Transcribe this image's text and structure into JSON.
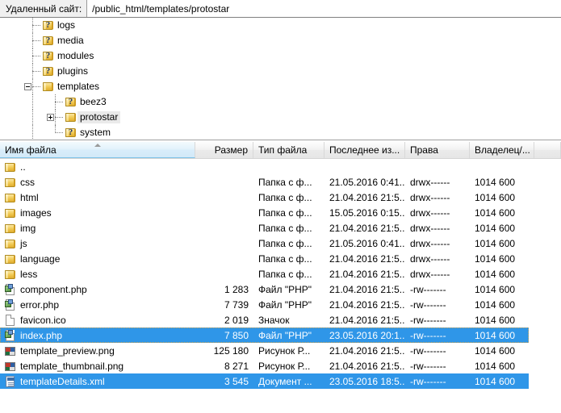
{
  "pathbar": {
    "label": "Удаленный сайт:",
    "path": "/public_html/templates/protostar"
  },
  "tree": {
    "items": [
      {
        "label": "logs",
        "icon": "folder-unknown-icon",
        "indent": 0,
        "expander": "none",
        "selected": false
      },
      {
        "label": "media",
        "icon": "folder-unknown-icon",
        "indent": 0,
        "expander": "none",
        "selected": false
      },
      {
        "label": "modules",
        "icon": "folder-unknown-icon",
        "indent": 0,
        "expander": "none",
        "selected": false
      },
      {
        "label": "plugins",
        "icon": "folder-unknown-icon",
        "indent": 0,
        "expander": "none",
        "selected": false
      },
      {
        "label": "templates",
        "icon": "folder-icon",
        "indent": 0,
        "expander": "collapse",
        "selected": false
      },
      {
        "label": "beez3",
        "icon": "folder-unknown-icon",
        "indent": 1,
        "expander": "none",
        "selected": false
      },
      {
        "label": "protostar",
        "icon": "folder-icon",
        "indent": 1,
        "expander": "expand",
        "selected": true
      },
      {
        "label": "system",
        "icon": "folder-unknown-icon",
        "indent": 1,
        "expander": "none",
        "selected": false
      }
    ]
  },
  "filelist": {
    "columns": [
      {
        "key": "name",
        "label": "Имя файла",
        "sorted": true
      },
      {
        "key": "size",
        "label": "Размер",
        "sorted": false
      },
      {
        "key": "type",
        "label": "Тип файла",
        "sorted": false
      },
      {
        "key": "mtime",
        "label": "Последнее из...",
        "sorted": false
      },
      {
        "key": "perms",
        "label": "Права",
        "sorted": false
      },
      {
        "key": "owner",
        "label": "Владелец/...",
        "sorted": false
      }
    ],
    "rows": [
      {
        "name": "..",
        "icon": "folder-icon",
        "size": "",
        "type": "",
        "mtime": "",
        "perms": "",
        "owner": "",
        "selected": false,
        "focused": false
      },
      {
        "name": "css",
        "icon": "folder-icon",
        "size": "",
        "type": "Папка с ф...",
        "mtime": "21.05.2016 0:41...",
        "perms": "drwx------",
        "owner": "1014 600",
        "selected": false,
        "focused": false
      },
      {
        "name": "html",
        "icon": "folder-icon",
        "size": "",
        "type": "Папка с ф...",
        "mtime": "21.04.2016 21:5...",
        "perms": "drwx------",
        "owner": "1014 600",
        "selected": false,
        "focused": false
      },
      {
        "name": "images",
        "icon": "folder-icon",
        "size": "",
        "type": "Папка с ф...",
        "mtime": "15.05.2016 0:15...",
        "perms": "drwx------",
        "owner": "1014 600",
        "selected": false,
        "focused": false
      },
      {
        "name": "img",
        "icon": "folder-icon",
        "size": "",
        "type": "Папка с ф...",
        "mtime": "21.04.2016 21:5...",
        "perms": "drwx------",
        "owner": "1014 600",
        "selected": false,
        "focused": false
      },
      {
        "name": "js",
        "icon": "folder-icon",
        "size": "",
        "type": "Папка с ф...",
        "mtime": "21.05.2016 0:41...",
        "perms": "drwx------",
        "owner": "1014 600",
        "selected": false,
        "focused": false
      },
      {
        "name": "language",
        "icon": "folder-icon",
        "size": "",
        "type": "Папка с ф...",
        "mtime": "21.04.2016 21:5...",
        "perms": "drwx------",
        "owner": "1014 600",
        "selected": false,
        "focused": false
      },
      {
        "name": "less",
        "icon": "folder-icon",
        "size": "",
        "type": "Папка с ф...",
        "mtime": "21.04.2016 21:5...",
        "perms": "drwx------",
        "owner": "1014 600",
        "selected": false,
        "focused": false
      },
      {
        "name": "component.php",
        "icon": "php-file-icon",
        "size": "1 283",
        "type": "Файл \"PHP\"",
        "mtime": "21.04.2016 21:5...",
        "perms": "-rw-------",
        "owner": "1014 600",
        "selected": false,
        "focused": false
      },
      {
        "name": "error.php",
        "icon": "php-file-icon",
        "size": "7 739",
        "type": "Файл \"PHP\"",
        "mtime": "21.04.2016 21:5...",
        "perms": "-rw-------",
        "owner": "1014 600",
        "selected": false,
        "focused": false
      },
      {
        "name": "favicon.ico",
        "icon": "blank-file-icon",
        "size": "2 019",
        "type": "Значок",
        "mtime": "21.04.2016 21:5...",
        "perms": "-rw-------",
        "owner": "1014 600",
        "selected": false,
        "focused": false
      },
      {
        "name": "index.php",
        "icon": "php-file-icon",
        "size": "7 850",
        "type": "Файл \"PHP\"",
        "mtime": "23.05.2016 20:1...",
        "perms": "-rw-------",
        "owner": "1014 600",
        "selected": true,
        "focused": true
      },
      {
        "name": "template_preview.png",
        "icon": "png-file-icon",
        "size": "125 180",
        "type": "Рисунок Р...",
        "mtime": "21.04.2016 21:5...",
        "perms": "-rw-------",
        "owner": "1014 600",
        "selected": false,
        "focused": false
      },
      {
        "name": "template_thumbnail.png",
        "icon": "png-file-icon",
        "size": "8 271",
        "type": "Рисунок Р...",
        "mtime": "21.04.2016 21:5...",
        "perms": "-rw-------",
        "owner": "1014 600",
        "selected": false,
        "focused": false
      },
      {
        "name": "templateDetails.xml",
        "icon": "xml-file-icon",
        "size": "3 545",
        "type": "Документ ...",
        "mtime": "23.05.2016 18:5...",
        "perms": "-rw-------",
        "owner": "1014 600",
        "selected": true,
        "focused": false
      }
    ]
  },
  "colors": {
    "selection": "#2f96e8",
    "header_sorted": "#d9edfa",
    "tree_selection": "#eaeaea"
  }
}
